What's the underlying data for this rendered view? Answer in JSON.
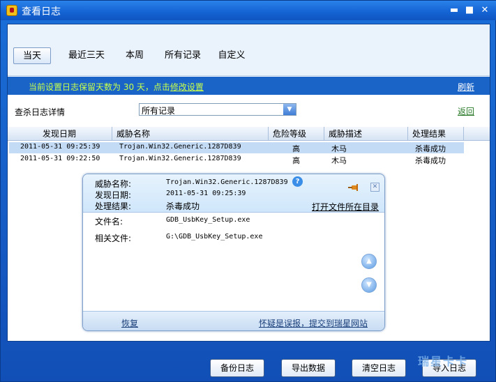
{
  "window": {
    "title": "查看日志"
  },
  "tabs": [
    {
      "label": "当天",
      "active": true
    },
    {
      "label": "最近三天",
      "active": false
    },
    {
      "label": "本周",
      "active": false
    },
    {
      "label": "所有记录",
      "active": false
    },
    {
      "label": "自定义",
      "active": false
    }
  ],
  "notice": {
    "text": "当前设置日志保留天数为 30 天，点击",
    "link": "修改设置"
  },
  "refresh_label": "刷新",
  "filter": {
    "label": "查杀日志详情",
    "selected": "所有记录",
    "back_label": "返回"
  },
  "table": {
    "columns": [
      "发现日期",
      "威胁名称",
      "危险等级",
      "威胁描述",
      "处理结果"
    ],
    "rows": [
      {
        "date": "2011-05-31 09:25:39",
        "threat": "Trojan.Win32.Generic.1287D839",
        "level": "高",
        "desc": "木马",
        "result": "杀毒成功"
      },
      {
        "date": "2011-05-31 09:22:50",
        "threat": "Trojan.Win32.Generic.1287D839",
        "level": "高",
        "desc": "木马",
        "result": "杀毒成功"
      }
    ]
  },
  "popup": {
    "threat_label": "威胁名称:",
    "threat_value": "Trojan.Win32.Generic.1287D839",
    "date_label": "发现日期:",
    "date_value": "2011-05-31 09:25:39",
    "result_label": "处理结果:",
    "result_value": "杀毒成功",
    "open_dir": "打开文件所在目录",
    "file_label": "文件名:",
    "file_value": "GDB_UsbKey_Setup.exe",
    "related_label": "相关文件:",
    "related_value": "G:\\GDB_UsbKey_Setup.exe",
    "restore": "恢复",
    "report": "怀疑是误报，提交到瑞星网站"
  },
  "buttons": {
    "backup": "备份日志",
    "export": "导出数据",
    "clear": "清空日志",
    "import": "导入日志"
  },
  "watermark": "瑞星卡卡",
  "colors": {
    "title_bar": "#1463d3",
    "notice_text": "#c8ff4a",
    "selected_row": "#c4dbf5"
  }
}
